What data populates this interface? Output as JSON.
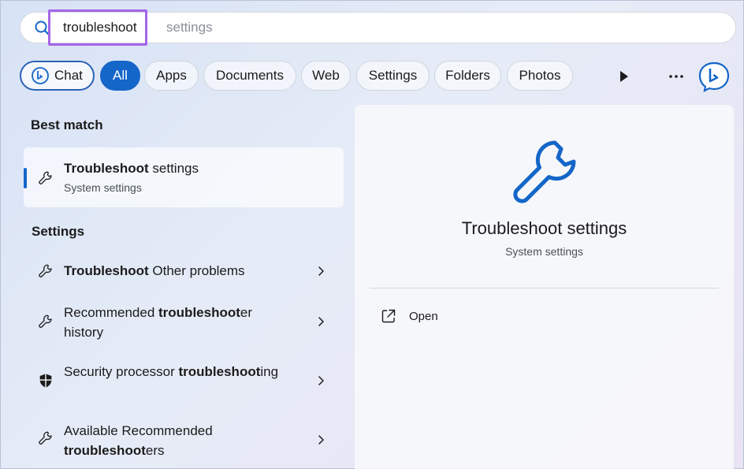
{
  "search": {
    "query": "troubleshoot",
    "suggestion": "settings"
  },
  "filters": [
    {
      "label": "Chat"
    },
    {
      "label": "All"
    },
    {
      "label": "Apps"
    },
    {
      "label": "Documents"
    },
    {
      "label": "Web"
    },
    {
      "label": "Settings"
    },
    {
      "label": "Folders"
    },
    {
      "label": "Photos"
    }
  ],
  "filters_active": "All",
  "best_match": {
    "heading": "Best match",
    "title_bold": "Troubleshoot",
    "title_rest": " settings",
    "subtitle": "System settings",
    "icon": "wrench-icon"
  },
  "settings_section": {
    "heading": "Settings",
    "items": [
      {
        "pre": "",
        "bold": "Troubleshoot",
        "post": " Other problems",
        "icon": "wrench-icon"
      },
      {
        "pre": "Recommended ",
        "bold": "troubleshoot",
        "post": "er history",
        "icon": "wrench-icon"
      },
      {
        "pre": "Security processor ",
        "bold": "troubleshoot",
        "post": "ing",
        "icon": "shield-icon"
      },
      {
        "pre": "Available Recommended ",
        "bold": "troubleshoot",
        "post": "ers",
        "icon": "wrench-icon"
      }
    ]
  },
  "detail": {
    "title": "Troubleshoot settings",
    "subtitle": "System settings",
    "actions": [
      {
        "label": "Open",
        "icon": "open-external-icon"
      }
    ]
  },
  "colors": {
    "accent": "#1466c8",
    "highlight": "#a566e8"
  }
}
